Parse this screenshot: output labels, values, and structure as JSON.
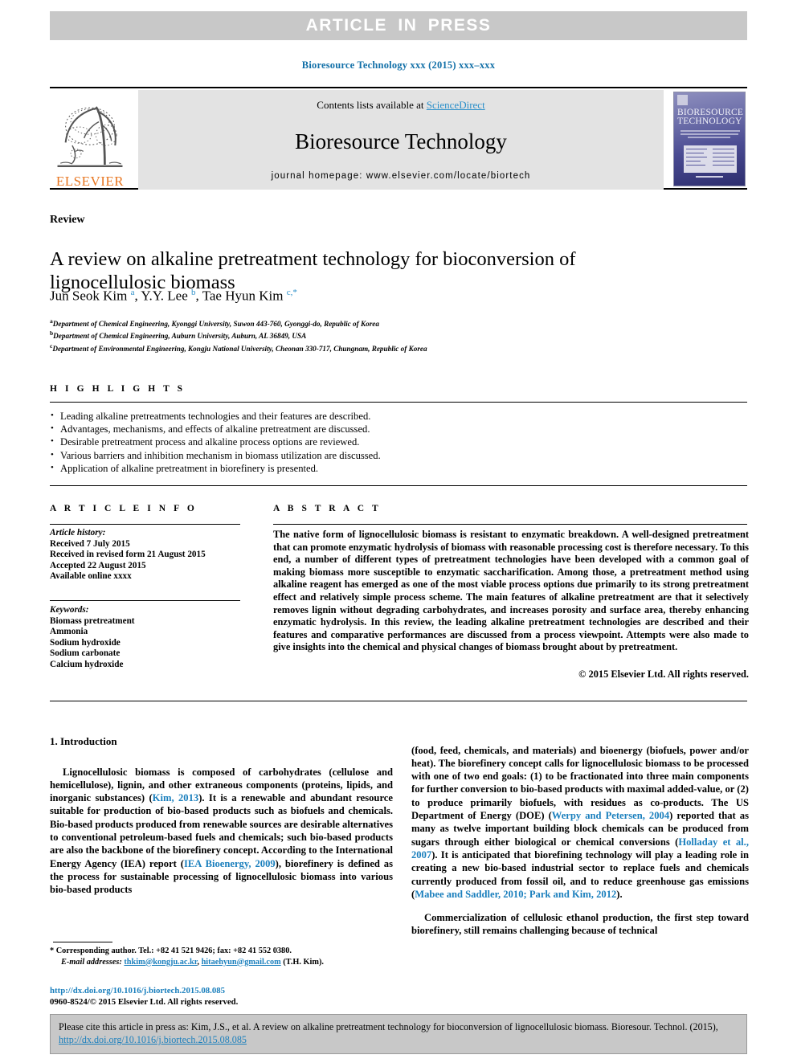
{
  "banner": {
    "text": "ARTICLE IN PRESS"
  },
  "running_head": "Bioresource Technology xxx (2015) xxx–xxx",
  "masthead": {
    "contents_prefix": "Contents lists available at ",
    "sciencedirect": "ScienceDirect",
    "journal_name": "Bioresource Technology",
    "homepage": "journal homepage: www.elsevier.com/locate/biortech",
    "publisher": "ELSEVIER",
    "cover_title": "BIORESOURCE TECHNOLOGY",
    "logo_icon": "elsevier-tree-icon"
  },
  "article": {
    "type": "Review",
    "title": "A review on alkaline pretreatment technology for bioconversion of lignocellulosic biomass",
    "authors_html": "Jun Seok Kim <sup>a</sup>, Y.Y. Lee <sup>b</sup>, Tae Hyun Kim <sup>c,*</sup>",
    "affiliations": [
      {
        "marker": "a",
        "text": "Department of Chemical Engineering, Kyonggi University, Suwon 443-760, Gyonggi-do, Republic of Korea"
      },
      {
        "marker": "b",
        "text": "Department of Chemical Engineering, Auburn University, Auburn, AL 36849, USA"
      },
      {
        "marker": "c",
        "text": "Department of Environmental Engineering, Kongju National University, Cheonan 330-717, Chungnam, Republic of Korea"
      }
    ]
  },
  "highlights": {
    "heading": "H I G H L I G H T S",
    "items": [
      "Leading alkaline pretreatments technologies and their features are described.",
      "Advantages, mechanisms, and effects of alkaline pretreatment are discussed.",
      "Desirable pretreatment process and alkaline process options are reviewed.",
      "Various barriers and inhibition mechanism in biomass utilization are discussed.",
      "Application of alkaline pretreatment in biorefinery is presented."
    ]
  },
  "article_info": {
    "heading": "A R T I C L E I N F O",
    "history_label": "Article history:",
    "history": [
      "Received 7 July 2015",
      "Received in revised form 21 August 2015",
      "Accepted 22 August 2015",
      "Available online xxxx"
    ],
    "keywords_label": "Keywords:",
    "keywords": [
      "Biomass pretreatment",
      "Ammonia",
      "Sodium hydroxide",
      "Sodium carbonate",
      "Calcium hydroxide"
    ]
  },
  "abstract": {
    "heading": "A B S T R A C T",
    "text": "The native form of lignocellulosic biomass is resistant to enzymatic breakdown. A well-designed pretreatment that can promote enzymatic hydrolysis of biomass with reasonable processing cost is therefore necessary. To this end, a number of different types of pretreatment technologies have been developed with a common goal of making biomass more susceptible to enzymatic saccharification. Among those, a pretreatment method using alkaline reagent has emerged as one of the most viable process options due primarily to its strong pretreatment effect and relatively simple process scheme. The main features of alkaline pretreatment are that it selectively removes lignin without degrading carbohydrates, and increases porosity and surface area, thereby enhancing enzymatic hydrolysis. In this review, the leading alkaline pretreatment technologies are described and their features and comparative performances are discussed from a process viewpoint. Attempts were also made to give insights into the chemical and physical changes of biomass brought about by pretreatment.",
    "copyright": "© 2015 Elsevier Ltd. All rights reserved."
  },
  "body": {
    "section_heading": "1. Introduction",
    "left_column_html": "<p class=\"indent\">Lignocellulosic biomass is composed of carbohydrates (cellulose and hemicellulose), lignin, and other extraneous components (proteins, lipids, and inorganic substances) (<span class=\"lnk\">Kim, 2013</span>). It is a renewable and abundant resource suitable for production of bio-based products such as biofuels and chemicals. Bio-based products produced from renewable sources are desirable alternatives to conventional petroleum-based fuels and chemicals; such bio-based products are also the backbone of the biorefinery concept. According to the International Energy Agency (IEA) report (<span class=\"lnk\">IEA Bioenergy, 2009</span>), biorefinery is defined as the process for sustainable processing of lignocellulosic biomass into various bio-based products</p>",
    "right_column_html": "<p>(food, feed, chemicals, and materials) and bioenergy (biofuels, power and/or heat). The biorefinery concept calls for lignocellulosic biomass to be processed with one of two end goals: (1) to be fractionated into three main components for further conversion to bio-based products with maximal added-value, or (2) to produce primarily biofuels, with residues as co-products. The US Department of Energy (DOE) (<span class=\"lnk\">Werpy and Petersen, 2004</span>) reported that as many as twelve important building block chemicals can be produced from sugars through either biological or chemical conversions (<span class=\"lnk\">Holladay et al., 2007</span>). It is anticipated that biorefining technology will play a leading role in creating a new bio-based industrial sector to replace fuels and chemicals currently produced from fossil oil, and to reduce greenhouse gas emissions (<span class=\"lnk\">Mabee and Saddler, 2010; Park and Kim, 2012</span>).</p><p class=\"indent\">Commercialization of cellulosic ethanol production, the first step toward biorefinery, still remains challenging because of technical</p>"
  },
  "footnote": {
    "corresponding": "* Corresponding author. Tel.: +82 41 521 9426; fax: +82 41 552 0380.",
    "email_label": "E-mail addresses:",
    "email_1": "thkim@kongju.ac.kr",
    "email_2": "hitaehyun@gmail.com",
    "email_suffix": "(T.H. Kim).",
    "doi": "http://dx.doi.org/10.1016/j.biortech.2015.08.085",
    "issn_copyright": "0960-8524/© 2015 Elsevier Ltd. All rights reserved."
  },
  "citation_box": {
    "prefix": "Please cite this article in press as: Kim, J.S., et al. A review on alkaline pretreatment technology for bioconversion of lignocellulosic biomass. Bioresour. Technol. (2015), ",
    "doi": "http://dx.doi.org/10.1016/j.biortech.2015.08.085"
  },
  "colors": {
    "banner_bg": "#c8c8c8",
    "link_blue": "#1a7fbd",
    "running_head_blue": "#1270a8",
    "elsevier_orange": "#E87722",
    "masthead_gray": "#e3e3e3"
  }
}
